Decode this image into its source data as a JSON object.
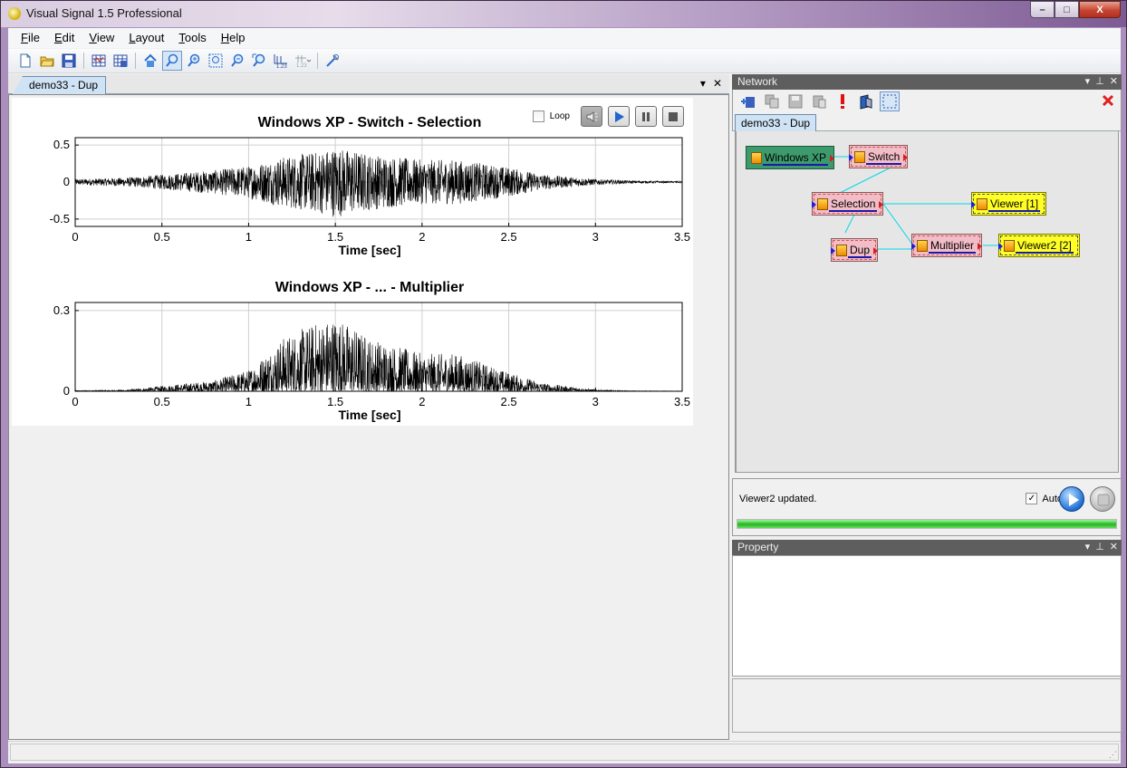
{
  "window": {
    "title": "Visual Signal 1.5 Professional",
    "min": "–",
    "max": "□",
    "close": "X"
  },
  "menu": {
    "items": [
      {
        "key": "F",
        "rest": "ile"
      },
      {
        "key": "E",
        "rest": "dit"
      },
      {
        "key": "V",
        "rest": "iew"
      },
      {
        "key": "L",
        "rest": "ayout"
      },
      {
        "key": "T",
        "rest": "ools"
      },
      {
        "key": "H",
        "rest": "elp"
      }
    ]
  },
  "document": {
    "tab": "demo33 - Dup",
    "tab_menu": "▾",
    "tab_close": "✕",
    "loop_label": "Loop"
  },
  "chart_data": [
    {
      "type": "line",
      "title": "Windows XP - Switch - Selection",
      "xlabel": "Time [sec]",
      "ylabel": "",
      "xlim": [
        0,
        3.5
      ],
      "ylim": [
        -0.6,
        0.6
      ],
      "x_ticks": [
        "0",
        "0.5",
        "1",
        "1.5",
        "2",
        "2.5",
        "3",
        "3.5"
      ],
      "y_ticks": [
        "0.5",
        "0",
        "-0.5"
      ],
      "y_tick_values": [
        0.5,
        0,
        -0.5
      ],
      "envelope": {
        "x": [
          0,
          0.3,
          0.5,
          0.8,
          1.0,
          1.2,
          1.4,
          1.5,
          1.7,
          2.0,
          2.2,
          2.5,
          2.7,
          3.0,
          3.2,
          3.5
        ],
        "amp": [
          0.04,
          0.06,
          0.1,
          0.16,
          0.22,
          0.34,
          0.42,
          0.48,
          0.38,
          0.3,
          0.3,
          0.2,
          0.1,
          0.04,
          0.02,
          0.01
        ]
      },
      "grid": true,
      "color": "#000000"
    },
    {
      "type": "line",
      "title": "Windows XP - ... - Multiplier",
      "xlabel": "Time [sec]",
      "ylabel": "",
      "xlim": [
        0,
        3.5
      ],
      "ylim": [
        0,
        0.33
      ],
      "x_ticks": [
        "0",
        "0.5",
        "1",
        "1.5",
        "2",
        "2.5",
        "3",
        "3.5"
      ],
      "y_ticks": [
        "0.3",
        "0"
      ],
      "y_tick_values": [
        0.3,
        0
      ],
      "envelope": {
        "x": [
          0,
          0.3,
          0.5,
          0.8,
          1.0,
          1.2,
          1.4,
          1.5,
          1.7,
          2.0,
          2.2,
          2.5,
          2.7,
          3.0,
          3.2,
          3.5
        ],
        "amp": [
          0.003,
          0.005,
          0.02,
          0.04,
          0.08,
          0.2,
          0.26,
          0.28,
          0.2,
          0.14,
          0.14,
          0.07,
          0.03,
          0.006,
          0.002,
          0.001
        ]
      },
      "grid": true,
      "color": "#000000"
    }
  ],
  "network": {
    "panel_title": "Network",
    "tab": "demo33 - Dup",
    "nodes": {
      "windows_xp": "Windows XP",
      "switch": "Switch",
      "selection": "Selection",
      "viewer1": "Viewer [1]",
      "dup": "Dup",
      "multiplier": "Multiplier",
      "viewer2": "Viewer2 [2]"
    },
    "link_color": "#00d8e8"
  },
  "status": {
    "text": "Viewer2 updated.",
    "auto_label": "Auto",
    "auto_checked": true,
    "progress": 1.0
  },
  "property": {
    "panel_title": "Property"
  },
  "colors": {
    "panel_header": "#5e5e5e",
    "tab_blue": "#cfe3f5",
    "source_node": "#3d9a6d",
    "process_node": "#f3bdc7",
    "viewer_node": "#ffff25",
    "progress": "#2ec42a"
  }
}
